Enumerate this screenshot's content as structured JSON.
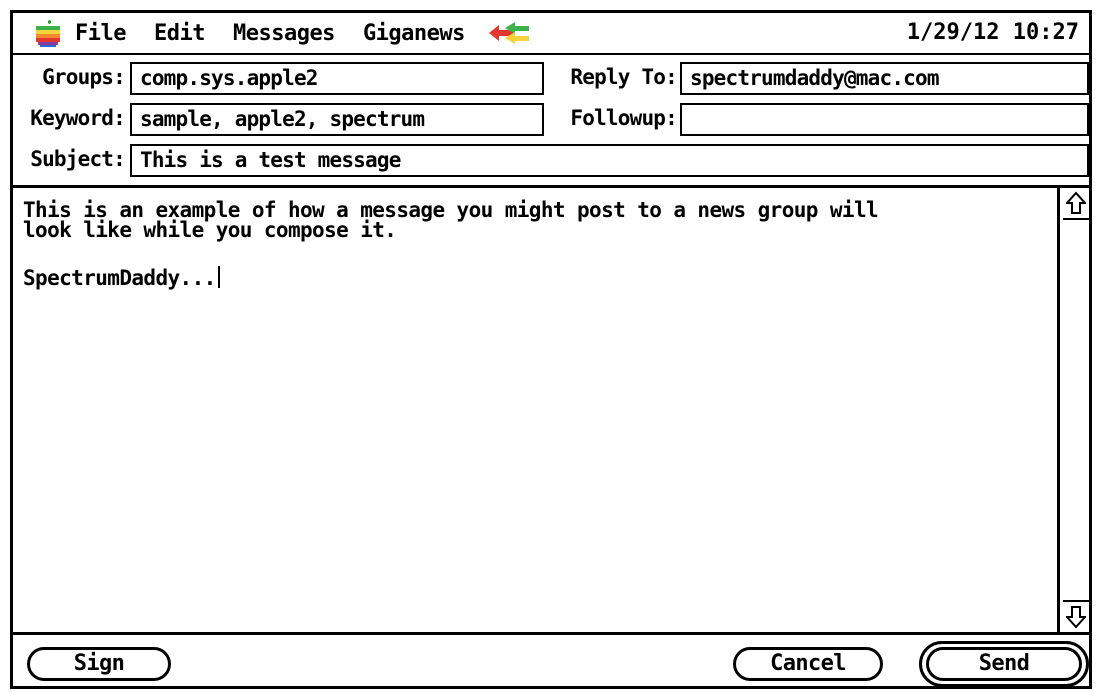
{
  "menubar": {
    "items": [
      "File",
      "Edit",
      "Messages",
      "Giganews"
    ],
    "clock": "1/29/12 10:27"
  },
  "fields": {
    "groups_label": "Groups:",
    "groups_value": "comp.sys.apple2",
    "reply_to_label": "Reply To:",
    "reply_to_value": "spectrumdaddy@mac.com",
    "keyword_label": "Keyword:",
    "keyword_value": "sample, apple2, spectrum",
    "followup_label": "Followup:",
    "followup_value": "",
    "subject_label": "Subject:",
    "subject_value": "This is a test message"
  },
  "body": {
    "line1": "This is an example of how a message you might post to a news group will",
    "line2": "look like while you compose it.",
    "line3": "",
    "line4": "SpectrumDaddy..."
  },
  "buttons": {
    "sign": "Sign",
    "cancel": "Cancel",
    "send": "Send"
  }
}
